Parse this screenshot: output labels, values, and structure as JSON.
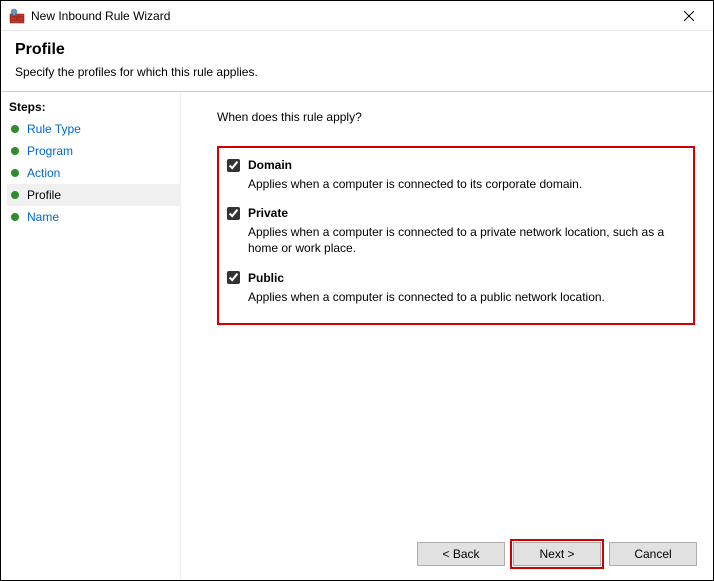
{
  "window": {
    "title": "New Inbound Rule Wizard"
  },
  "header": {
    "title": "Profile",
    "subtitle": "Specify the profiles for which this rule applies."
  },
  "sidebar": {
    "label": "Steps:",
    "items": [
      {
        "label": "Rule Type",
        "active": false
      },
      {
        "label": "Program",
        "active": false
      },
      {
        "label": "Action",
        "active": false
      },
      {
        "label": "Profile",
        "active": true
      },
      {
        "label": "Name",
        "active": false
      }
    ]
  },
  "main": {
    "prompt": "When does this rule apply?",
    "options": [
      {
        "label": "Domain",
        "checked": true,
        "description": "Applies when a computer is connected to its corporate domain."
      },
      {
        "label": "Private",
        "checked": true,
        "description": "Applies when a computer is connected to a private network location, such as a home or work place."
      },
      {
        "label": "Public",
        "checked": true,
        "description": "Applies when a computer is connected to a public network location."
      }
    ]
  },
  "buttons": {
    "back": "< Back",
    "next": "Next >",
    "cancel": "Cancel"
  }
}
